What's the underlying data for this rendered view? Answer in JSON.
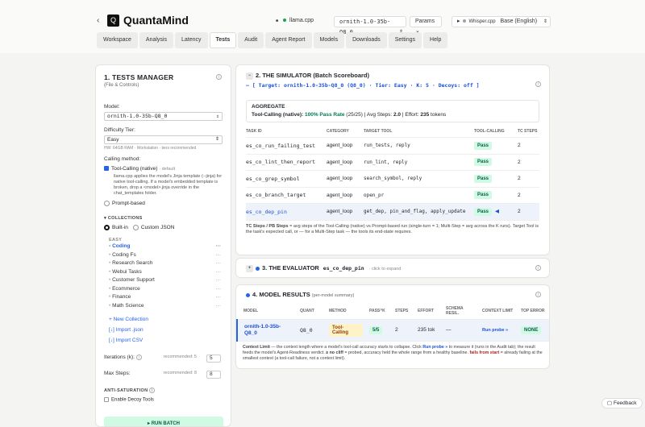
{
  "brand": {
    "name": "QuantaMind",
    "logo": "Q",
    "back": "‹"
  },
  "header": {
    "engine_icon": "■",
    "engine": "llama.cpp",
    "model": "ornith-1.0-35b-Q8_0",
    "params": "Params ⌄",
    "play": "▸",
    "whisper": "Whisper.cpp",
    "language": "Base (English)",
    "chev": "⇕"
  },
  "nav": [
    "Workspace",
    "Analysis",
    "Latency",
    "Tests",
    "Audit",
    "Agent Report",
    "Models",
    "Downloads",
    "Settings",
    "Help"
  ],
  "nav_active": 3,
  "left": {
    "title": "1. TESTS MANAGER",
    "subtitle": "(File & Controls)",
    "model_label": "Model:",
    "model_value": "ornith-1.0-35b-Q8_0",
    "tier_label": "Difficulty Tier:",
    "tier_value": "Easy",
    "tier_hint": "HW: 64GB RAM · Workstation · tiers recommended",
    "calling_label": "Calling method:",
    "native_label": "Tool-Calling (native)",
    "native_default": "· default",
    "native_desc": "llama.cpp applies the model's Jinja template (--jinja) for native tool-calling. If a model's embedded template is broken, drop a <model>.jinja override in the chat_templates folder.",
    "prompt_label": "Prompt-based",
    "collections_label": "COLLECTIONS",
    "builtin": "Built-in",
    "custom": "Custom JSON",
    "easy_label": "EASY",
    "collections": [
      "Coding",
      "Coding Fs",
      "Research Search",
      "Webui Tasks",
      "Customer Support",
      "Ecommerce",
      "Finance",
      "Math Science"
    ],
    "ellipsis": "···",
    "new_collection": "+ New Collection",
    "import_json": "[↓] Import .json",
    "import_csv": "[↓] Import CSV",
    "iterations_label": "Iterations (k):",
    "iterations_rec": "recommended: 5",
    "iterations_value": "5",
    "maxsteps_label": "Max Steps:",
    "maxsteps_rec": "recommended: 8",
    "maxsteps_value": "8",
    "anti_label": "ANTI-SATURATION",
    "decoy_label": "Enable Decoy Tools",
    "run_label": "▸ RUN BATCH"
  },
  "sim": {
    "title": "2. THE SIMULATOR (Batch Scoreboard)",
    "target": "— [ Target: ornith-1.0-35b-Q8_0 (Q8_0) · Tier: Easy · K: 5 · Decoys: off ]",
    "agg_title": "AGGREGATE",
    "agg_tc": "Tool-Calling (native):",
    "agg_rate": "100% Pass Rate",
    "agg_count": "(25/25)",
    "agg_steps_label": "| Avg Steps:",
    "agg_steps": "2.0",
    "agg_effort_label": "| Effort:",
    "agg_effort": "235",
    "agg_tokens": "tokens",
    "columns": [
      "TASK ID",
      "CATEGORY",
      "TARGET TOOL",
      "TOOL-CALLING",
      "TC STEPS"
    ],
    "rows": [
      {
        "id": "es_co_run_failing_test",
        "category": "agent_loop",
        "tool": "run_tests, reply",
        "status": "Pass",
        "steps": "2"
      },
      {
        "id": "es_co_lint_then_report",
        "category": "agent_loop",
        "tool": "run_lint, reply",
        "status": "Pass",
        "steps": "2"
      },
      {
        "id": "es_co_grep_symbol",
        "category": "agent_loop",
        "tool": "search_symbol, reply",
        "status": "Pass",
        "steps": "2"
      },
      {
        "id": "es_co_branch_target",
        "category": "agent_loop",
        "tool": "open_pr",
        "status": "Pass",
        "steps": "2"
      },
      {
        "id": "es_co_dep_pin",
        "category": "agent_loop",
        "tool": "get_dep, pin_and_flag, apply_update",
        "status": "Pass",
        "steps": "2"
      }
    ],
    "foot_bold": "TC Steps / PB Steps",
    "foot_text": " = avg steps of the Tool-Calling (native) vs Prompt-based run (single-turn = 1; Multi-Step = avg across the K runs). Target Tool is the task's expected call, or — for a Multi-Step task — the tools its end-state requires."
  },
  "eval": {
    "title": "3. THE EVALUATOR",
    "task": "es_co_dep_pin",
    "hint": "· click to expand"
  },
  "results": {
    "title": "4. MODEL RESULTS",
    "sub": "(per-model summary)",
    "columns": [
      "MODEL",
      "QUANT",
      "METHOD",
      "PASS^K",
      "STEPS",
      "EFFORT",
      "SCHEMA RESIL.",
      "CONTEXT LIMIT",
      "TOP ERROR"
    ],
    "row": {
      "model": "ornith-1.0-35b-Q8_0",
      "quant": "Q8_0",
      "method": "Tool-Calling",
      "pass": "5/5",
      "steps": "2",
      "effort": "235 tok",
      "schema": "—",
      "context": "Run probe »",
      "error": "NONE"
    },
    "note_bold": "Context Limit",
    "note_a": " — the context length where a model's tool-call accuracy starts to collapse. Click ",
    "note_run": "Run probe »",
    "note_b": " to measure it (runs in the Audit tab); the result feeds the model's Agent-Readiness verdict. ",
    "note_nocliff": "≥ no cliff",
    "note_c": " = probed, accuracy held the whole range from a healthy baseline. ",
    "note_fails": "fails from start",
    "note_d": " = already failing at the smallest context (a tool-call failure, not a context limit)."
  },
  "feedback": "Feedback"
}
